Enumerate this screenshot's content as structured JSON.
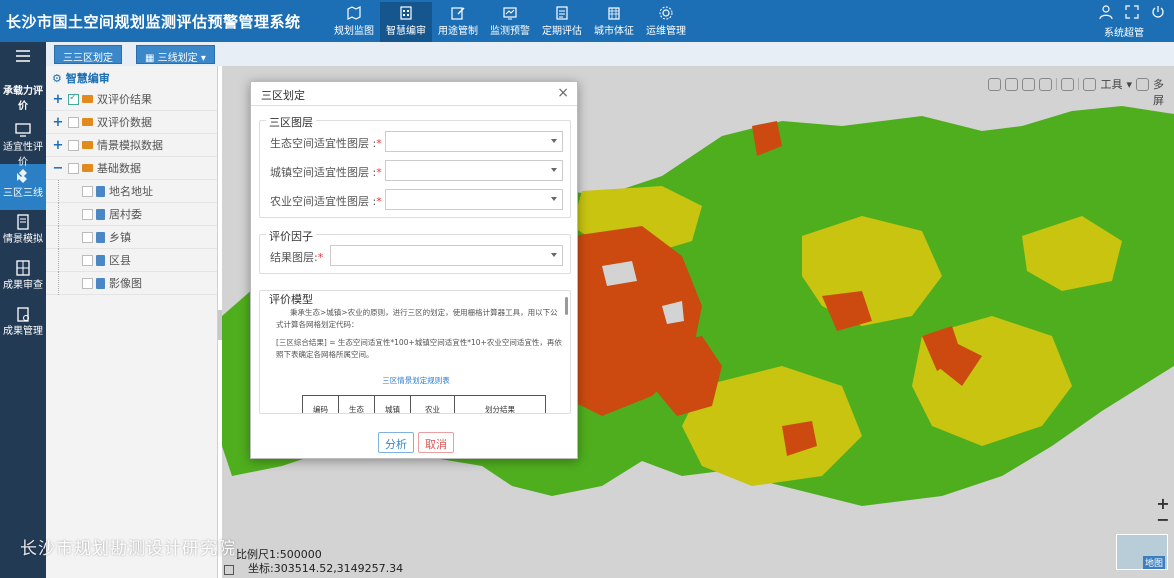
{
  "app": {
    "title": "长沙市国土空间规划监测评估预警管理系统"
  },
  "topnav": {
    "items": [
      {
        "label": "规划监图",
        "icon": "map-icon"
      },
      {
        "label": "智慧编审",
        "icon": "building-icon",
        "active": true
      },
      {
        "label": "用途管制",
        "icon": "edit-icon"
      },
      {
        "label": "监测预警",
        "icon": "monitor-icon"
      },
      {
        "label": "定期评估",
        "icon": "report-icon"
      },
      {
        "label": "城市体征",
        "icon": "city-icon"
      },
      {
        "label": "运维管理",
        "icon": "gear-icon"
      }
    ]
  },
  "user": {
    "label": "系统超管"
  },
  "rail": {
    "items": [
      {
        "label": "承载力评价",
        "icon": "scale-icon"
      },
      {
        "label": "适宜性评价",
        "icon": "screen-icon"
      },
      {
        "label": "三区三线",
        "icon": "diamond-icon",
        "active": true
      },
      {
        "label": "情景模拟",
        "icon": "document-icon"
      },
      {
        "label": "成果审查",
        "icon": "grid-icon"
      },
      {
        "label": "成果管理",
        "icon": "clipboard-icon"
      }
    ]
  },
  "tabs": {
    "tab1": "三三区划定",
    "tab2": "三线划定"
  },
  "tree": {
    "title": "智慧编审",
    "nodes": [
      {
        "label": "双评价结果",
        "type": "folder",
        "exp": "+",
        "checked": true
      },
      {
        "label": "双评价数据",
        "type": "folder",
        "exp": "+"
      },
      {
        "label": "情景模拟数据",
        "type": "folder",
        "exp": "+"
      },
      {
        "label": "基础数据",
        "type": "folder",
        "exp": "−"
      },
      {
        "label": "地名地址",
        "type": "file"
      },
      {
        "label": "居村委",
        "type": "file"
      },
      {
        "label": "乡镇",
        "type": "file"
      },
      {
        "label": "区县",
        "type": "file"
      },
      {
        "label": "影像图",
        "type": "file"
      }
    ]
  },
  "map": {
    "toolbar_tools": "工具",
    "toolbar_more": "多",
    "fullscreen": "屏",
    "scale": "比例尺1:500000",
    "coords": "坐标:303514.52,3149257.34",
    "minimap_label": "地图",
    "colors": {
      "ecology": "#4fae1e",
      "town": "#cc4a10",
      "agri": "#c8c410",
      "base": "#d3d3d3"
    }
  },
  "watermark": "长沙市规划勘测设计研究院",
  "dialog": {
    "title": "三区划定",
    "section1": {
      "legend": "三区图层",
      "fields": [
        {
          "label": "生态空间适宜性图层 :",
          "value": ""
        },
        {
          "label": "城镇空间适宜性图层 :",
          "value": ""
        },
        {
          "label": "农业空间适宜性图层 :",
          "value": ""
        }
      ]
    },
    "section2": {
      "legend": "评价因子",
      "fields": [
        {
          "label": "结果图层:",
          "value": ""
        }
      ]
    },
    "section3": {
      "legend": "评价模型",
      "para1": "秉承生态>城镇>农业的原则，进行三区的划定，使用栅格计算器工具，用以下公式计算各网格划定代码：",
      "para2": "[三区综合结果] = 生态空间适宜性*100+城镇空间适宜性*10+农业空间适宜性，再依照下表确定各网格所属空间。",
      "table_title": "三区情景划定规则表",
      "table_headers": [
        "编码",
        "生态",
        "城镇",
        "农业",
        "划分结果"
      ]
    },
    "buttons": {
      "analyze": "分析",
      "cancel": "取消"
    }
  }
}
